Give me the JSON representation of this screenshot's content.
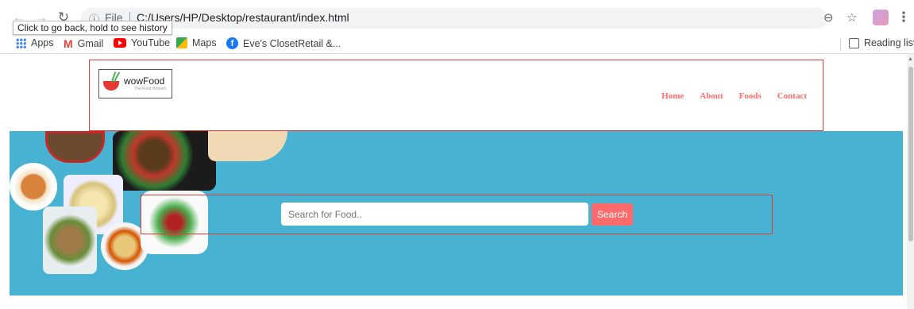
{
  "browser": {
    "url_scheme": "File",
    "url": "C:/Users/HP/Desktop/restaurant/index.html",
    "tooltip": "Click to go back, hold to see history",
    "bookmarks": [
      {
        "label": "Apps",
        "icon": "apps-grid-icon"
      },
      {
        "label": "Gmail",
        "icon": "gmail-icon"
      },
      {
        "label": "YouTube",
        "icon": "youtube-icon"
      },
      {
        "label": "Maps",
        "icon": "maps-icon"
      },
      {
        "label": "Eve's ClosetRetail &...",
        "icon": "facebook-icon"
      }
    ],
    "reading_list": "Reading list"
  },
  "site": {
    "logo": {
      "name": "wowFood",
      "tagline": "The Food Heaven"
    },
    "menu": [
      "Home",
      "About",
      "Foods",
      "Contact"
    ],
    "search": {
      "placeholder": "Search for Food..",
      "button": "Search"
    },
    "colors": {
      "accent": "#ff6b6b",
      "hero_bg": "#48b2d2",
      "border": "#e53935"
    }
  }
}
